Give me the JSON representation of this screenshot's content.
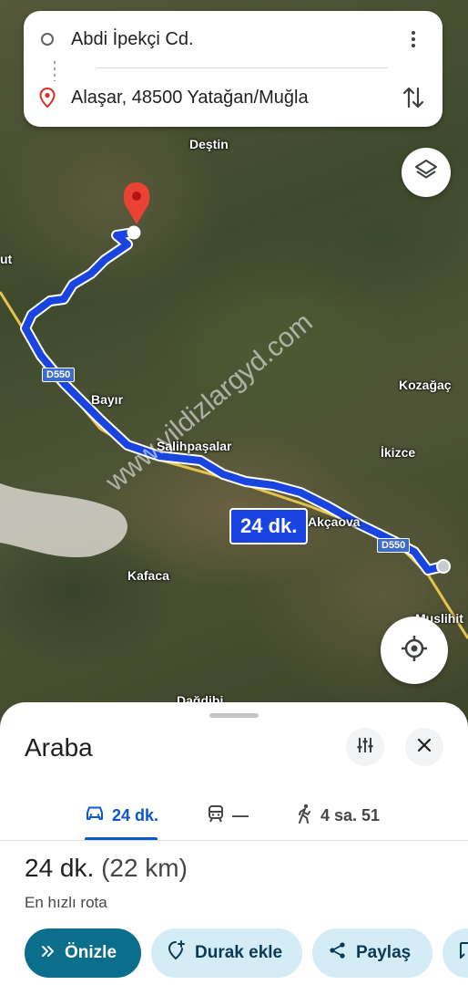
{
  "search": {
    "origin": "Abdi İpekçi Cd.",
    "destination": "Alaşar, 48500 Yatağan/Muğla"
  },
  "map": {
    "places": {
      "destin": "Deştin",
      "ut": "ut",
      "bayir": "Bayır",
      "salihpasalar": "Salihpaşalar",
      "akcaova": "Akçaova",
      "kozagac": "Kozağaç",
      "ikizce": "İkizce",
      "kafaca": "Kafaca",
      "muslihit": "Muslihit",
      "dagdibi": "Dağdibi"
    },
    "road_label_1": "D550",
    "road_label_2": "D550",
    "route_time": "24 dk.",
    "watermark": "www.yildizlargyd.com",
    "route_color": "#1a44e0"
  },
  "sheet": {
    "title": "Araba",
    "tabs": [
      {
        "label": "24 dk.",
        "icon": "car-icon"
      },
      {
        "label": "—",
        "icon": "train-icon"
      },
      {
        "label": "4 sa. 51",
        "icon": "walk-icon"
      }
    ],
    "duration": "24 dk.",
    "distance": "(22 km)",
    "route_note": "En hızlı rota",
    "actions": {
      "preview": "Önizle",
      "add_stop": "Durak ekle",
      "share": "Paylaş"
    }
  }
}
